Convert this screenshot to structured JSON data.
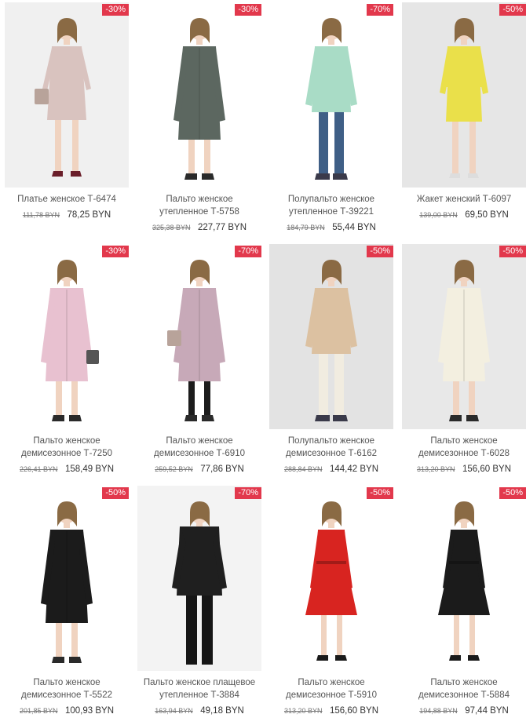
{
  "products": [
    {
      "name": "Платье женское Т-6474",
      "old_price": "111,78 BYN",
      "price": "78,25 BYN",
      "discount": "-30%",
      "bg": "#f0f0f0",
      "fill": "#d9c3bf",
      "accent": "#c9aa9c",
      "garment": "dress",
      "accessory": "bag-left"
    },
    {
      "name": "Пальто женское утепленное Т-5758",
      "old_price": "325,38 BYN",
      "price": "227,77 BYN",
      "discount": "-30%",
      "bg": "#ffffff",
      "fill": "#5c6760",
      "accent": "#2f2f2f",
      "garment": "coat",
      "accessory": "none"
    },
    {
      "name": "Полупальто женское утепленное Т-39221",
      "old_price": "184,79 BYN",
      "price": "55,44 BYN",
      "discount": "-70%",
      "bg": "#ffffff",
      "fill": "#a9dcc6",
      "accent": "#3f5f86",
      "garment": "short",
      "accessory": "none"
    },
    {
      "name": "Жакет женский Т-6097",
      "old_price": "139,00 BYN",
      "price": "69,50 BYN",
      "discount": "-50%",
      "bg": "#e6e6e6",
      "fill": "#eae04a",
      "accent": "#eae04a",
      "garment": "suit",
      "accessory": "none"
    },
    {
      "name": "Пальто женское демисезонное Т-7250",
      "old_price": "226,41 BYN",
      "price": "158,49 BYN",
      "discount": "-30%",
      "bg": "#ffffff",
      "fill": "#e8c1d0",
      "accent": "#c79fb0",
      "garment": "coat",
      "accessory": "bag-right"
    },
    {
      "name": "Пальто женское демисезонное Т-6910",
      "old_price": "259,52 BYN",
      "price": "77,86 BYN",
      "discount": "-70%",
      "bg": "#ffffff",
      "fill": "#c7a9b8",
      "accent": "#1c1c1c",
      "garment": "coat",
      "accessory": "bag-left"
    },
    {
      "name": "Полупальто женское демисезонное Т-6162",
      "old_price": "288,84 BYN",
      "price": "144,42 BYN",
      "discount": "-50%",
      "bg": "#e3e3e3",
      "fill": "#dcc1a1",
      "accent": "#f1ece0",
      "garment": "short",
      "accessory": "none"
    },
    {
      "name": "Пальто женское демисезонное Т-6028",
      "old_price": "313,20 BYN",
      "price": "156,60 BYN",
      "discount": "-50%",
      "bg": "#e8e8e8",
      "fill": "#f3efe0",
      "accent": "#e5e0d0",
      "garment": "coat",
      "accessory": "none"
    },
    {
      "name": "Пальто женское демисезонное Т-5522",
      "old_price": "201,85 BYN",
      "price": "100,93 BYN",
      "discount": "-50%",
      "bg": "#ffffff",
      "fill": "#1b1b1b",
      "accent": "#1b1b1b",
      "garment": "coat",
      "accessory": "none"
    },
    {
      "name": "Пальто женское плащевое утепленное Т-3884",
      "old_price": "163,94 BYN",
      "price": "49,18 BYN",
      "discount": "-70%",
      "bg": "#f3f3f3",
      "fill": "#1f1f1f",
      "accent": "#1f1f1f",
      "garment": "puffer",
      "accessory": "none"
    },
    {
      "name": "Пальто женское демисезонное Т-5910",
      "old_price": "313,20 BYN",
      "price": "156,60 BYN",
      "discount": "-50%",
      "bg": "#ffffff",
      "fill": "#d82420",
      "accent": "#d82420",
      "garment": "flare",
      "accessory": "none"
    },
    {
      "name": "Пальто женское демисезонное Т-5884",
      "old_price": "194,88 BYN",
      "price": "97,44 BYN",
      "discount": "-50%",
      "bg": "#ffffff",
      "fill": "#1b1b1b",
      "accent": "#1b1b1b",
      "garment": "flare",
      "accessory": "none"
    }
  ]
}
